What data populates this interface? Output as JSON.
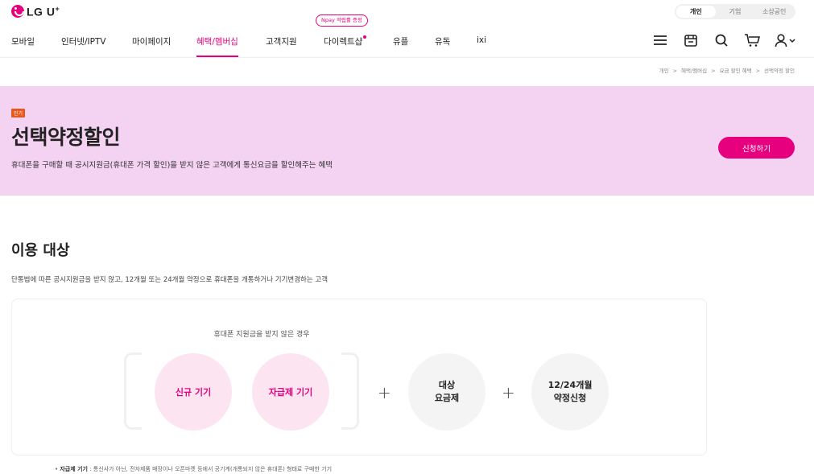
{
  "brand": {
    "logo_text": "LG U",
    "logo_sup": "+"
  },
  "segment": {
    "items": [
      "개인",
      "기업",
      "소상공인"
    ],
    "active": 0
  },
  "nav": {
    "items": [
      "모바일",
      "인터넷/IPTV",
      "마이페이지",
      "혜택/멤버십",
      "고객지원",
      "다이렉트샵",
      "유플",
      "유독",
      "ixi"
    ],
    "active_index": 3,
    "npay_badge": "Npay 적립률 증정",
    "icons": [
      "menu-icon",
      "store-icon",
      "search-icon",
      "cart-icon",
      "user-icon"
    ]
  },
  "breadcrumb": [
    "개인",
    "혜택/멤버십",
    "요금 할인 혜택",
    "선택약정 할인"
  ],
  "hero": {
    "badge": "인기",
    "title": "선택약정할인",
    "desc": "휴대폰을 구매할 때 공시지원금(휴대폰 가격 할인)을 받지 않은 고객에게 통신요금을 할인해주는 혜택",
    "apply_label": "신청하기"
  },
  "section": {
    "title": "이용 대상",
    "desc": "단통법에 따른 공시지원금을 받지 않고, 12개월 또는 24개월 약정으로 휴대폰을 개통하거나 기기변경하는 고객"
  },
  "card": {
    "caption": "휴대폰 지원금을 받지 않은 경우",
    "circle1": "신규 기기",
    "circle2": "자급제 기기",
    "plus": "+",
    "circle3_l1": "대상",
    "circle3_l2": "요금제",
    "circle4_l1": "12/24개월",
    "circle4_l2": "약정신청"
  },
  "footnote": {
    "term": "자급제 기기",
    "text": " : 통신사가 아닌, 전자제품 매장이나 오픈마켓 등에서 공기계(개통되지 않은 휴대폰) 형태로 구매한 기기"
  },
  "colors": {
    "brand": "#e6007e",
    "hero_bg": "#f4d2f2",
    "badge": "#e8581c"
  }
}
